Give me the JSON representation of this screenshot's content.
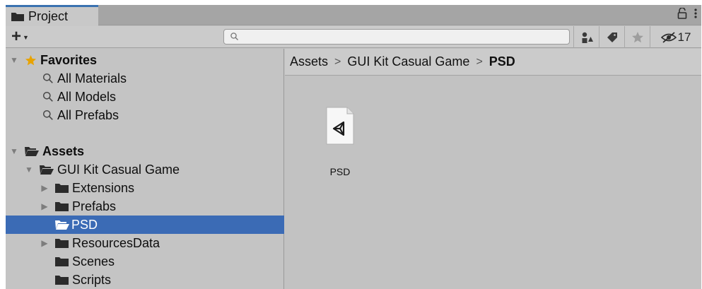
{
  "tab": {
    "title": "Project"
  },
  "toolbar": {
    "create_label": "+",
    "search_value": "",
    "hidden_count": "17"
  },
  "favorites": {
    "header": "Favorites",
    "items": [
      {
        "label": "All Materials"
      },
      {
        "label": "All Models"
      },
      {
        "label": "All Prefabs"
      }
    ]
  },
  "assets": {
    "header": "Assets",
    "root_folder": "GUI Kit Casual Game",
    "children": [
      {
        "label": "Extensions"
      },
      {
        "label": "Prefabs"
      },
      {
        "label": "PSD"
      },
      {
        "label": "ResourcesData"
      },
      {
        "label": "Scenes"
      },
      {
        "label": "Scripts"
      }
    ]
  },
  "breadcrumb": {
    "items": [
      "Assets",
      "GUI Kit Casual Game",
      "PSD"
    ]
  },
  "content": {
    "asset_label": "PSD"
  },
  "colors": {
    "selection": "#3b6bb5",
    "tab_accent": "#3a72b0",
    "favorite_star": "#e8a300"
  }
}
